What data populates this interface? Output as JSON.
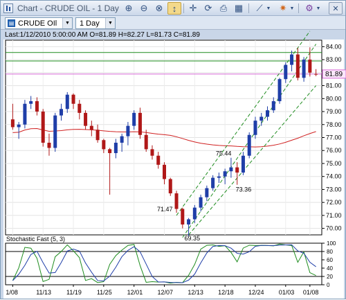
{
  "window": {
    "title": "Chart - CRUDE OIL - 1 Day"
  },
  "toolbar": {
    "buttons": [
      {
        "name": "zoom-in-icon",
        "glyph": "⊕"
      },
      {
        "name": "zoom-out-icon",
        "glyph": "⊖"
      },
      {
        "name": "zoom-fit-icon",
        "glyph": "⊗"
      },
      {
        "name": "cursor-icon",
        "glyph": "↕"
      },
      {
        "name": "crosshair-icon",
        "glyph": "✛"
      },
      {
        "name": "refresh-icon",
        "glyph": "⟳"
      },
      {
        "name": "print-icon",
        "glyph": "⎙"
      },
      {
        "name": "calendar-icon",
        "glyph": "▦"
      },
      {
        "name": "draw-line-icon",
        "glyph": "⟋"
      },
      {
        "name": "indicator-icon",
        "glyph": "✷"
      },
      {
        "name": "studies-icon",
        "glyph": "⚙"
      }
    ]
  },
  "symbol_field": {
    "value": "CRUDE OIl"
  },
  "interval_field": {
    "value": "1 Day"
  },
  "quote_line": "Last:1/12/2010 5:00:00 AM O=81.89 H=82.27 L=81.73 C=81.89",
  "price_axis": {
    "ticks": [
      "84.00",
      "83.00",
      "82.00",
      "81.00",
      "80.00",
      "79.00",
      "78.00",
      "77.00",
      "76.00",
      "75.00",
      "74.00",
      "73.00",
      "72.00",
      "71.00",
      "70.00"
    ],
    "current": "81.89"
  },
  "annotations": [
    "75.44",
    "73.36",
    "71.47",
    "69.35"
  ],
  "stochastic": {
    "title": "Stochastic Fast (5, 3)",
    "ticks": [
      "100",
      "80",
      "60",
      "40",
      "20",
      "0"
    ]
  },
  "x_axis": {
    "ticks": [
      "1/08",
      "11/13",
      "11/19",
      "11/25",
      "12/01",
      "12/07",
      "12/13",
      "12/18",
      "12/24",
      "01/03",
      "01/08"
    ]
  },
  "chart_data": {
    "type": "candlestick",
    "title": "CRUDE OIL - 1 Day",
    "ylim": [
      69.5,
      84.5
    ],
    "candles": [
      [
        78.4,
        79.6,
        77.6,
        77.8
      ],
      [
        77.8,
        78.2,
        76.9,
        78.0
      ],
      [
        78.0,
        79.9,
        77.7,
        79.6
      ],
      [
        79.6,
        80.2,
        79.2,
        79.8
      ],
      [
        79.8,
        80.1,
        78.7,
        79.0
      ],
      [
        79.0,
        79.2,
        76.3,
        76.6
      ],
      [
        76.6,
        77.3,
        75.6,
        76.2
      ],
      [
        76.2,
        78.9,
        75.9,
        78.7
      ],
      [
        78.7,
        79.6,
        78.3,
        79.2
      ],
      [
        79.2,
        80.5,
        78.9,
        80.3
      ],
      [
        80.3,
        80.4,
        79.2,
        79.6
      ],
      [
        79.6,
        79.9,
        78.4,
        78.9
      ],
      [
        78.9,
        79.1,
        77.6,
        77.9
      ],
      [
        77.9,
        78.3,
        77.1,
        77.6
      ],
      [
        77.6,
        78.0,
        76.6,
        76.8
      ],
      [
        76.8,
        76.9,
        75.8,
        76.1
      ],
      [
        76.1,
        76.2,
        72.6,
        75.8
      ],
      [
        75.8,
        76.9,
        75.4,
        76.6
      ],
      [
        76.6,
        77.3,
        75.9,
        77.1
      ],
      [
        77.1,
        78.2,
        76.4,
        77.9
      ],
      [
        77.9,
        79.1,
        77.6,
        78.9
      ],
      [
        78.9,
        79.3,
        76.9,
        77.2
      ],
      [
        77.2,
        77.6,
        75.9,
        76.1
      ],
      [
        76.1,
        76.4,
        75.3,
        75.6
      ],
      [
        75.6,
        75.9,
        74.6,
        74.9
      ],
      [
        74.9,
        75.1,
        73.4,
        73.8
      ],
      [
        73.8,
        73.9,
        72.5,
        72.7
      ],
      [
        72.7,
        72.9,
        71.2,
        71.5
      ],
      [
        71.5,
        71.6,
        70.0,
        70.3
      ],
      [
        70.3,
        70.8,
        69.4,
        70.7
      ],
      [
        70.7,
        71.8,
        70.4,
        71.6
      ],
      [
        71.6,
        72.6,
        71.3,
        72.4
      ],
      [
        72.4,
        73.3,
        72.1,
        73.1
      ],
      [
        73.1,
        74.1,
        72.9,
        73.9
      ],
      [
        73.9,
        74.3,
        73.5,
        74.0
      ],
      [
        74.0,
        74.6,
        73.4,
        74.4
      ],
      [
        74.4,
        75.44,
        73.9,
        74.7
      ],
      [
        74.7,
        75.1,
        73.36,
        74.3
      ],
      [
        74.3,
        75.9,
        74.1,
        75.6
      ],
      [
        75.6,
        77.4,
        75.4,
        77.2
      ],
      [
        77.2,
        78.6,
        76.9,
        78.3
      ],
      [
        78.3,
        78.9,
        77.9,
        78.6
      ],
      [
        78.6,
        79.4,
        78.3,
        79.1
      ],
      [
        79.1,
        80.1,
        78.9,
        79.8
      ],
      [
        79.8,
        81.6,
        79.6,
        81.5
      ],
      [
        81.5,
        82.8,
        81.2,
        82.6
      ],
      [
        82.6,
        83.7,
        82.1,
        83.4
      ],
      [
        83.4,
        83.9,
        81.4,
        81.6
      ],
      [
        81.6,
        83.2,
        81.3,
        83.0
      ],
      [
        83.0,
        83.95,
        81.7,
        82.0
      ],
      [
        81.9,
        82.27,
        81.73,
        81.89
      ]
    ]
  }
}
